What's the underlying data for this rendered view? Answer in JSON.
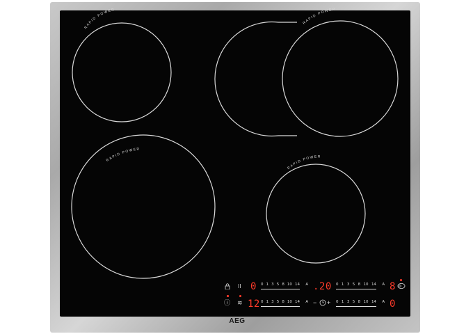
{
  "brand": "AEG",
  "zone_labels": {
    "top_left": "RAPID POWER",
    "top_right": "RAPID POWER",
    "bottom_left": "RAPID POWER",
    "bottom_right": "RAPID POWER"
  },
  "controls": {
    "row1": {
      "left_display": "0",
      "timer_display": ".20",
      "right_display": "8",
      "scale_left": [
        "0",
        "1",
        "3",
        "5",
        "8",
        "10",
        "14"
      ],
      "scale_right": [
        "0",
        "1",
        "3",
        "5",
        "8",
        "10",
        "14"
      ],
      "scale_end": "A"
    },
    "row2": {
      "left_display": "12",
      "right_display": "0",
      "timer_minus": "−",
      "timer_plus": "+",
      "scale_left": [
        "0",
        "1",
        "3",
        "5",
        "8",
        "10",
        "14"
      ],
      "scale_right": [
        "0",
        "1",
        "3",
        "5",
        "8",
        "10",
        "14"
      ],
      "scale_end": "A"
    },
    "pause_symbol": "II",
    "lock_symbol": "🔒",
    "info_symbol": "ⓘ",
    "heat_symbol": "≋"
  },
  "colors": {
    "led": "#ff3b2a",
    "glass": "#050505",
    "ring": "#d9d9d9"
  }
}
